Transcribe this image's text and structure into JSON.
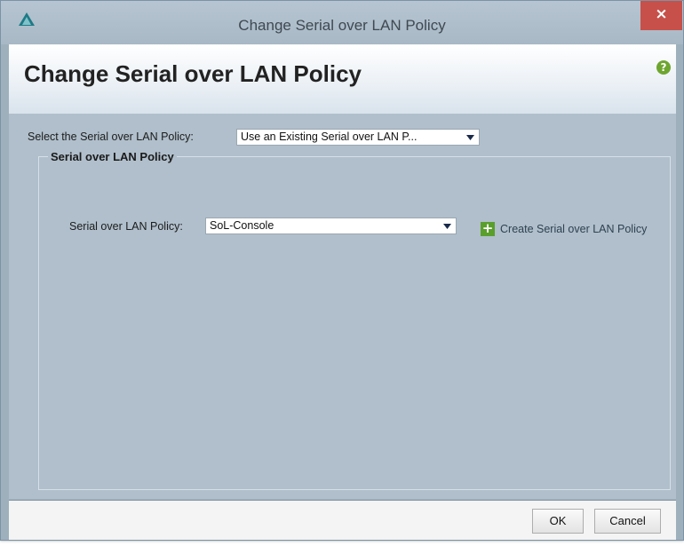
{
  "window": {
    "title": "Change Serial over LAN Policy",
    "close_label": "×"
  },
  "header": {
    "title": "Change Serial over LAN Policy",
    "help_label": "?"
  },
  "policy_select": {
    "label": "Select the Serial over LAN Policy:",
    "value": "Use an Existing Serial over LAN P..."
  },
  "group": {
    "title": "Serial over LAN Policy",
    "field_label": "Serial over LAN Policy:",
    "field_value": "SoL-Console",
    "create_label": "Create Serial over LAN Policy"
  },
  "footer": {
    "ok_label": "OK",
    "cancel_label": "Cancel"
  },
  "colors": {
    "close": "#c7504a",
    "help": "#6ea52f",
    "plus": "#5a9e2c",
    "content_bg": "#b0bfcb"
  },
  "icons": [
    "app-logo-icon",
    "close-icon",
    "help-icon",
    "chevron-down-icon",
    "plus-icon"
  ]
}
